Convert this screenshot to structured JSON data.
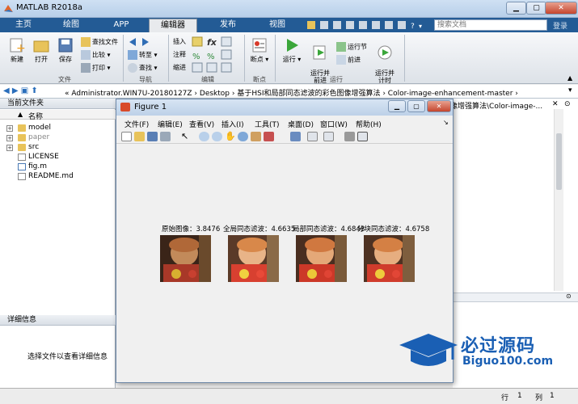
{
  "window": {
    "title": "MATLAB R2018a"
  },
  "tabs": [
    {
      "label": "主页"
    },
    {
      "label": "绘图"
    },
    {
      "label": "APP"
    },
    {
      "label": "编辑器"
    },
    {
      "label": "发布"
    },
    {
      "label": "视图"
    }
  ],
  "search": {
    "placeholder": "搜索文档"
  },
  "login": "登录",
  "ribbon": {
    "file": {
      "new": "新建",
      "open": "打开",
      "save": "保存",
      "find_files": "查找文件",
      "compare": "比较",
      "print": "打印",
      "group": "文件"
    },
    "nav": {
      "goto": "转至",
      "find": "查找",
      "group": "导航"
    },
    "edit": {
      "insert": "插入",
      "comment": "注释",
      "indent": "缩进",
      "group": "编辑"
    },
    "breakpoints": {
      "label": "断点",
      "group": "断点"
    },
    "run": {
      "run": "运行",
      "run_advance": "运行并\n前进",
      "run_section": "运行节",
      "advance": "前进",
      "run_time": "运行并\n计时",
      "group": "运行"
    }
  },
  "address": {
    "path": "« Administrator.WIN7U-20180127Z  ›  Desktop  ›  基于HSI和局部同态滤波的彩色图像增强算法  ›  Color-image-enhancement-master  ›"
  },
  "left_panel": {
    "header": "当前文件夹",
    "column": "名称",
    "items": [
      {
        "name": "model",
        "type": "folder",
        "expandable": true
      },
      {
        "name": "paper",
        "type": "folder",
        "expandable": true
      },
      {
        "name": "src",
        "type": "folder",
        "expandable": true
      },
      {
        "name": "LICENSE",
        "type": "file"
      },
      {
        "name": "fig.m",
        "type": "m-file"
      },
      {
        "name": "README.md",
        "type": "file"
      }
    ],
    "details_header": "详细信息",
    "details_text": "选择文件以查看详细信息"
  },
  "right_panel": {
    "path": "图像增强算法\\Color-image-..."
  },
  "status": {
    "row_label": "行",
    "row_value": "1",
    "col_label": "列",
    "col_value": "1"
  },
  "figure": {
    "title": "Figure 1",
    "menu": [
      "文件(F)",
      "编辑(E)",
      "查看(V)",
      "插入(I)",
      "工具(T)",
      "桌面(D)",
      "窗口(W)",
      "帮助(H)"
    ],
    "subplots": [
      {
        "caption": "原始图像：3.8476"
      },
      {
        "caption": "全局同态滤波：4.6635"
      },
      {
        "caption": "局部同态滤波：4.6848"
      },
      {
        "caption": "分块同态滤波：4.6758"
      }
    ]
  },
  "watermark": {
    "line1": "必过源码",
    "line2": "Biguo100.com"
  }
}
